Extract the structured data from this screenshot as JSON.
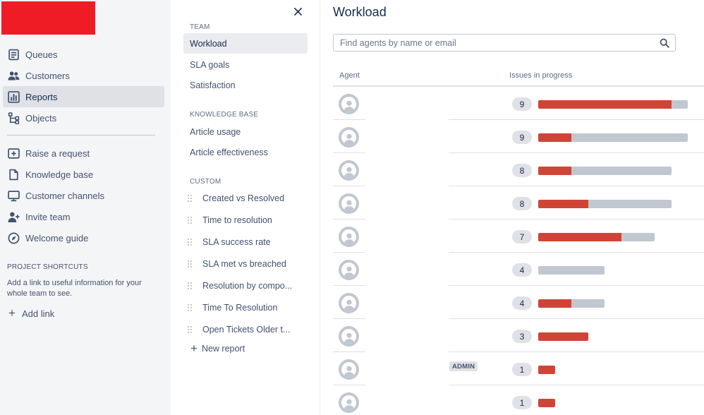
{
  "sidebar": {
    "brand_color": "#ef1c25",
    "nav": [
      {
        "label": "Queues",
        "icon": "queues-icon"
      },
      {
        "label": "Customers",
        "icon": "customers-icon"
      },
      {
        "label": "Reports",
        "icon": "reports-icon",
        "active": true
      },
      {
        "label": "Objects",
        "icon": "objects-icon"
      }
    ],
    "secondary": [
      {
        "label": "Raise a request",
        "icon": "raise-request-icon"
      },
      {
        "label": "Knowledge base",
        "icon": "knowledge-base-icon"
      },
      {
        "label": "Customer channels",
        "icon": "customer-channels-icon"
      },
      {
        "label": "Invite team",
        "icon": "invite-team-icon"
      },
      {
        "label": "Welcome guide",
        "icon": "welcome-guide-icon"
      }
    ],
    "shortcuts_heading": "PROJECT SHORTCUTS",
    "shortcuts_help": "Add a link to useful information for your whole team to see.",
    "add_link": "Add link"
  },
  "reports_nav": {
    "team_heading": "TEAM",
    "team_items": [
      "Workload",
      "SLA goals",
      "Satisfaction"
    ],
    "kb_heading": "KNOWLEDGE BASE",
    "kb_items": [
      "Article usage",
      "Article effectiveness"
    ],
    "custom_heading": "CUSTOM",
    "custom_items": [
      "Created vs Resolved",
      "Time to resolution",
      "SLA success rate",
      "SLA met vs breached",
      "Resolution by compo...",
      "Time To Resolution",
      "Open Tickets Older t..."
    ],
    "new_report": "New report"
  },
  "main": {
    "title": "Workload",
    "search_placeholder": "Find agents by name or email",
    "columns": {
      "agent": "Agent",
      "issues": "Issues in progress"
    },
    "bar_colors": {
      "assigned": "#d04437",
      "track": "#c1c7d0"
    },
    "rows": [
      {
        "count": "9",
        "total": 9,
        "highlight": 8,
        "badge": ""
      },
      {
        "count": "9",
        "total": 9,
        "highlight": 2,
        "badge": ""
      },
      {
        "count": "8",
        "total": 8,
        "highlight": 2,
        "badge": ""
      },
      {
        "count": "8",
        "total": 8,
        "highlight": 3,
        "badge": ""
      },
      {
        "count": "7",
        "total": 7,
        "highlight": 5,
        "badge": ""
      },
      {
        "count": "4",
        "total": 4,
        "highlight": 0,
        "badge": ""
      },
      {
        "count": "4",
        "total": 4,
        "highlight": 2,
        "badge": ""
      },
      {
        "count": "3",
        "total": 3,
        "highlight": 3,
        "badge": ""
      },
      {
        "count": "1",
        "total": 1,
        "highlight": 1,
        "badge": "ADMIN"
      },
      {
        "count": "1",
        "total": 1,
        "highlight": 1,
        "badge": ""
      }
    ]
  }
}
